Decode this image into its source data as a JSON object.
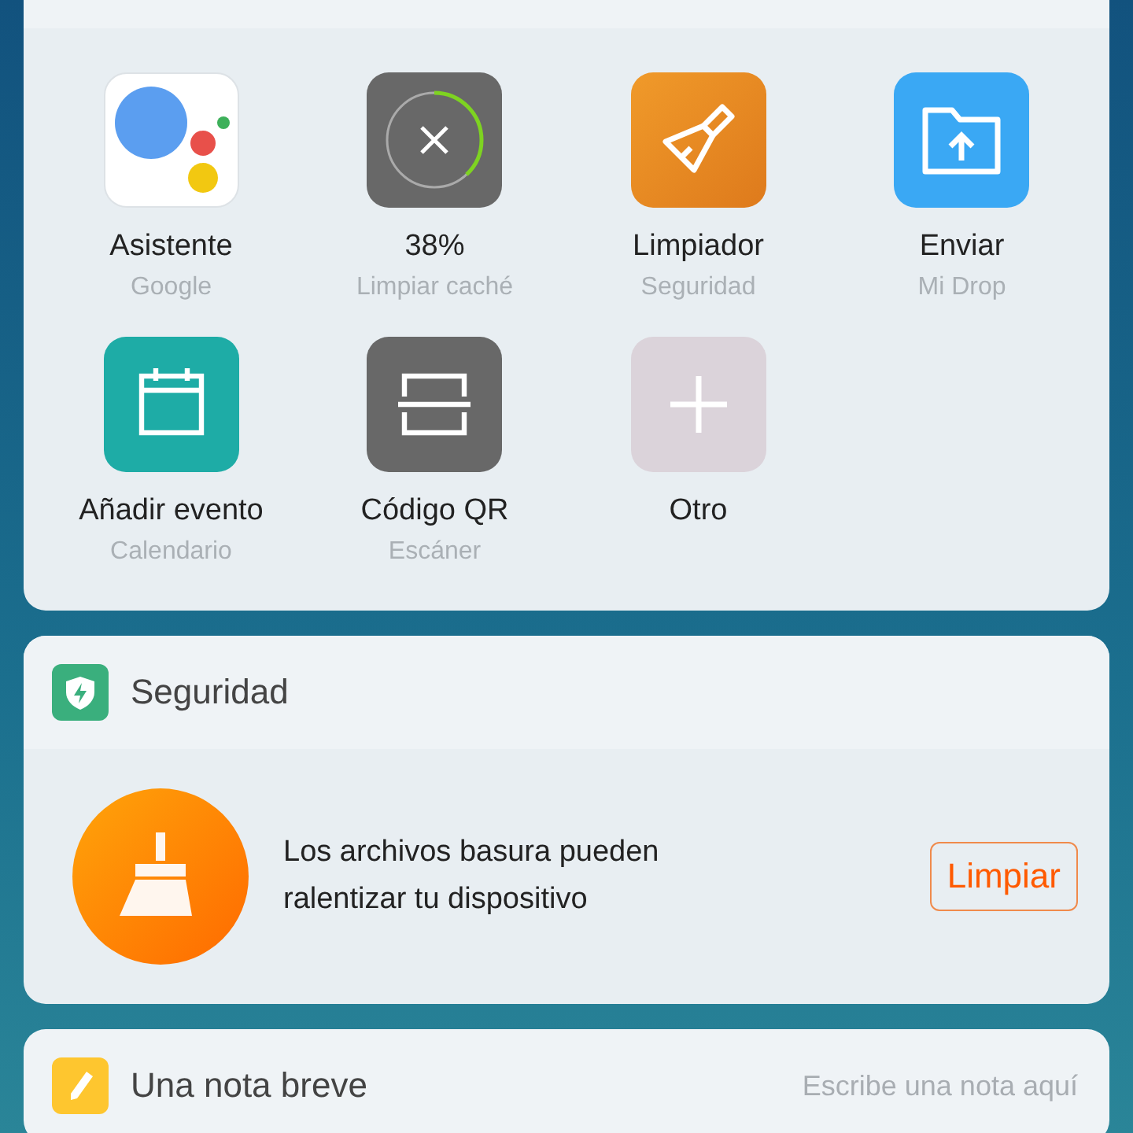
{
  "shortcuts": [
    {
      "kind": "assistant",
      "label": "Asistente",
      "sublabel": "Google"
    },
    {
      "kind": "cache",
      "label": "38%",
      "sublabel": "Limpiar caché",
      "level": 0.38
    },
    {
      "kind": "cleaner",
      "label": "Limpiador",
      "sublabel": "Seguridad"
    },
    {
      "kind": "send",
      "label": "Enviar",
      "sublabel": "Mi Drop"
    },
    {
      "kind": "calendar",
      "label": "Añadir evento",
      "sublabel": "Calendario"
    },
    {
      "kind": "scanner",
      "label": "Código QR",
      "sublabel": "Escáner"
    },
    {
      "kind": "add",
      "label": "Otro"
    }
  ],
  "security": {
    "title": "Seguridad",
    "message": "Los archivos basura pueden ralentizar tu dispositivo",
    "button": "Limpiar"
  },
  "note": {
    "title": "Una nota breve",
    "placeholder": "Escribe una nota aquí"
  }
}
